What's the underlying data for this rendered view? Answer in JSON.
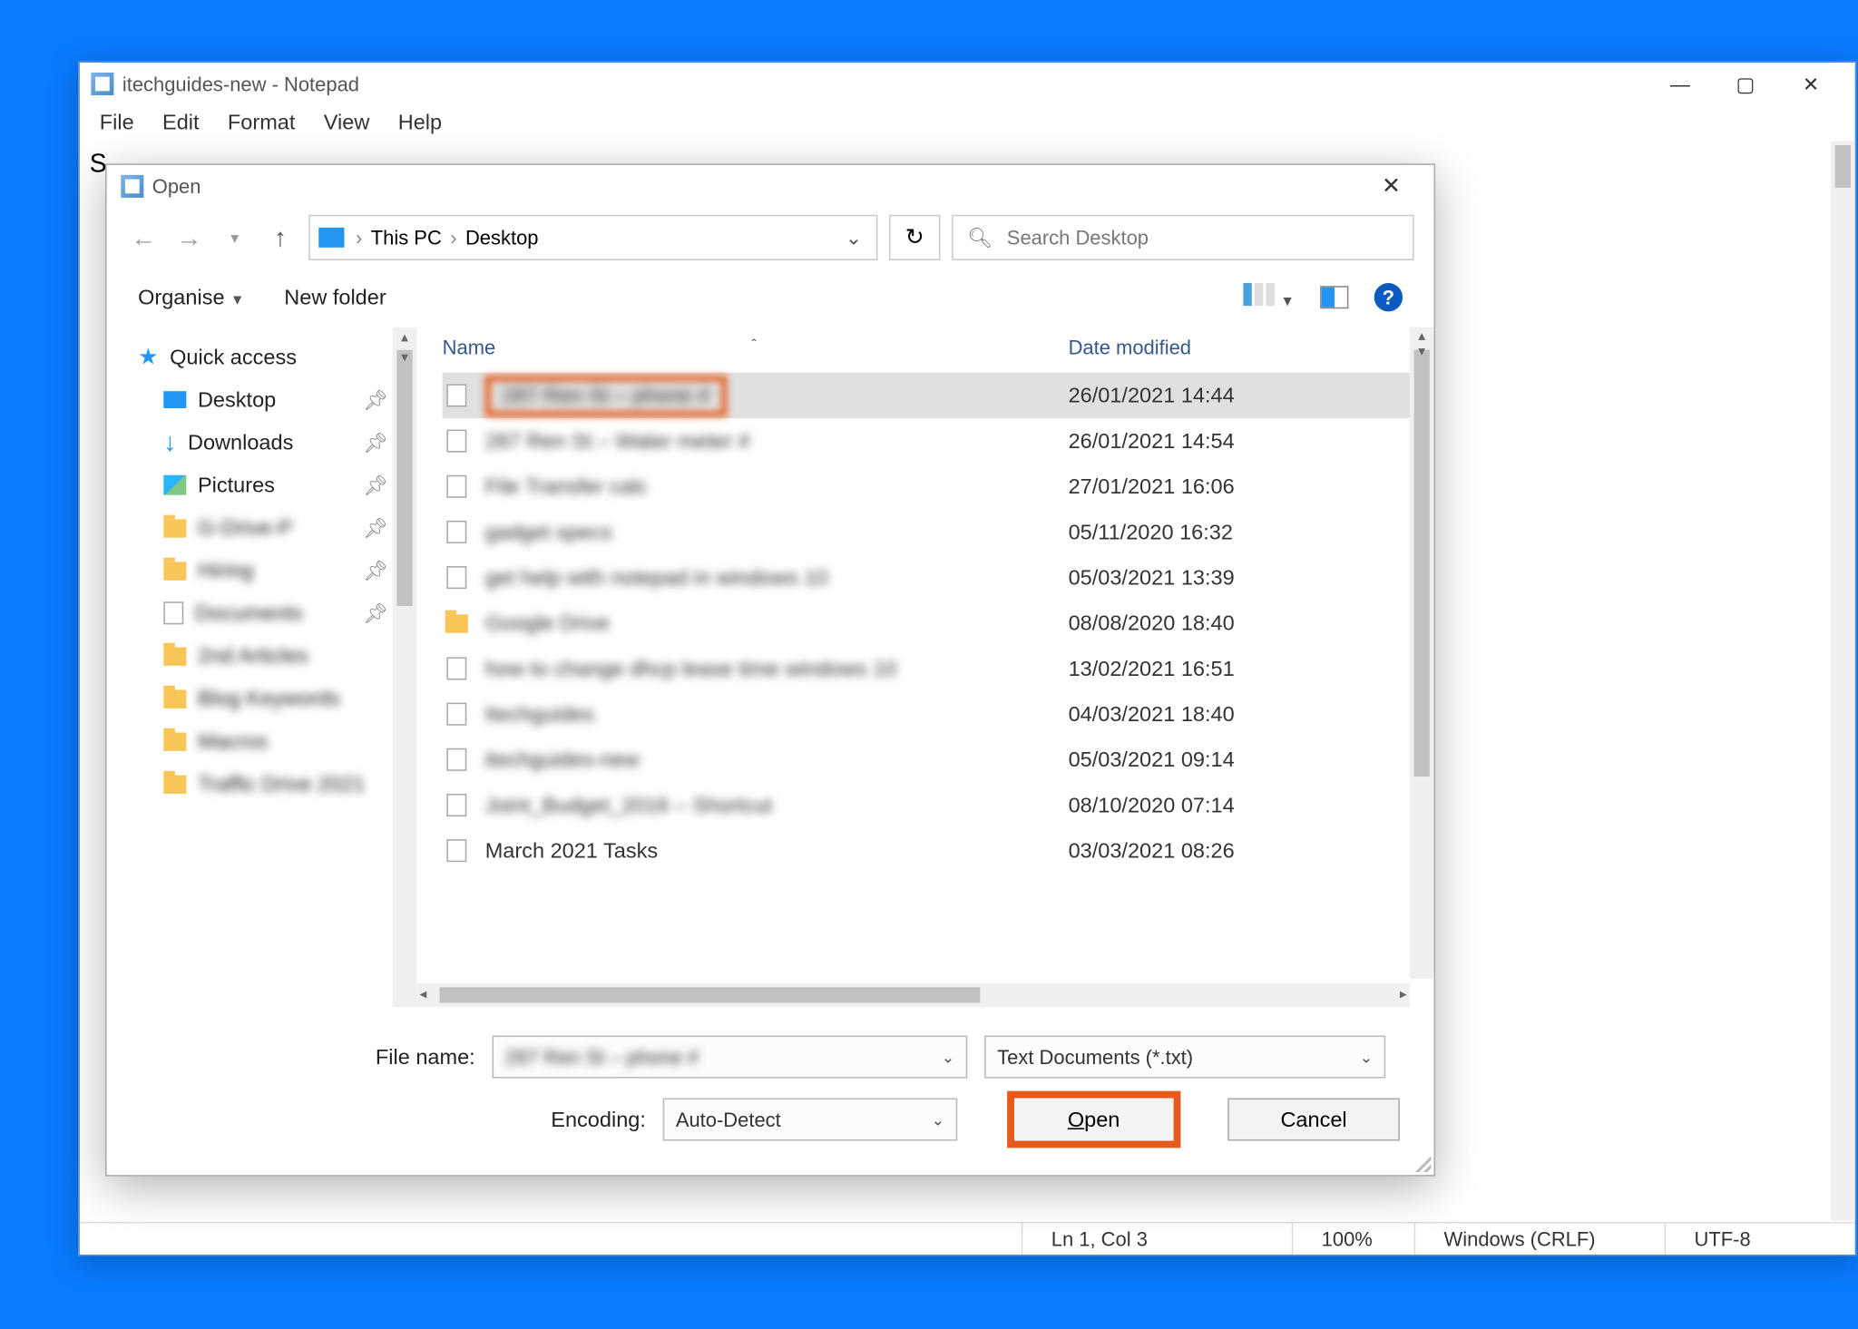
{
  "notepad": {
    "title": "itechguides-new - Notepad",
    "menu": [
      "File",
      "Edit",
      "Format",
      "View",
      "Help"
    ],
    "status": {
      "pos": "Ln 1, Col 3",
      "zoom": "100%",
      "eol": "Windows (CRLF)",
      "enc": "UTF-8"
    },
    "body_text": "S"
  },
  "dialog": {
    "title": "Open",
    "breadcrumb": {
      "root": "This PC",
      "leaf": "Desktop"
    },
    "search_placeholder": "Search Desktop",
    "toolbar": {
      "organise": "Organise",
      "newfolder": "New folder"
    },
    "columns": {
      "name": "Name",
      "date": "Date modified"
    },
    "tree": {
      "header": "Quick access",
      "items": [
        {
          "label": "Desktop",
          "pin": true,
          "type": "desk"
        },
        {
          "label": "Downloads",
          "pin": true,
          "type": "dl"
        },
        {
          "label": "Pictures",
          "pin": true,
          "type": "pic"
        },
        {
          "label": "G-Drive-P",
          "pin": true,
          "type": "fold",
          "blur": true
        },
        {
          "label": "Hiring",
          "pin": true,
          "type": "fold",
          "blur": true
        },
        {
          "label": "Documents",
          "pin": true,
          "type": "file",
          "blur": true
        },
        {
          "label": "2nd Articles",
          "pin": false,
          "type": "fold",
          "blur": true
        },
        {
          "label": "Blog Keywords",
          "pin": false,
          "type": "fold",
          "blur": true
        },
        {
          "label": "Macros",
          "pin": false,
          "type": "fold",
          "blur": true
        },
        {
          "label": "Traffic Drive 2021",
          "pin": false,
          "type": "fold",
          "blur": true
        }
      ]
    },
    "files": [
      {
        "name": "287 Ren St – phone #",
        "date": "26/01/2021 14:44",
        "type": "file",
        "selected": true,
        "blur": true,
        "highlight": true
      },
      {
        "name": "287 Ren St – Water meter #",
        "date": "26/01/2021 14:54",
        "type": "file",
        "blur": true
      },
      {
        "name": "File Transfer calc",
        "date": "27/01/2021 16:06",
        "type": "file",
        "blur": true
      },
      {
        "name": "gadget specs",
        "date": "05/11/2020 16:32",
        "type": "file",
        "blur": true
      },
      {
        "name": "get help with notepad in windows 10",
        "date": "05/03/2021 13:39",
        "type": "file",
        "blur": true
      },
      {
        "name": "Google Drive",
        "date": "08/08/2020 18:40",
        "type": "fold",
        "blur": true
      },
      {
        "name": "how to change dhcp lease time windows 10",
        "date": "13/02/2021 16:51",
        "type": "file",
        "blur": true
      },
      {
        "name": "Itechguides",
        "date": "04/03/2021 18:40",
        "type": "file",
        "blur": true
      },
      {
        "name": "itechguides-new",
        "date": "05/03/2021 09:14",
        "type": "file",
        "blur": true
      },
      {
        "name": "Joint_Budget_2016 – Shortcut",
        "date": "08/10/2020 07:14",
        "type": "file",
        "blur": true
      },
      {
        "name": "March 2021 Tasks",
        "date": "03/03/2021 08:26",
        "type": "file",
        "blur": false
      }
    ],
    "bottom": {
      "filename_label": "File name:",
      "filename_value": "287 Ren St – phone #",
      "filter": "Text Documents (*.txt)",
      "encoding_label": "Encoding:",
      "encoding_value": "Auto-Detect",
      "open": "Open",
      "cancel": "Cancel"
    }
  }
}
